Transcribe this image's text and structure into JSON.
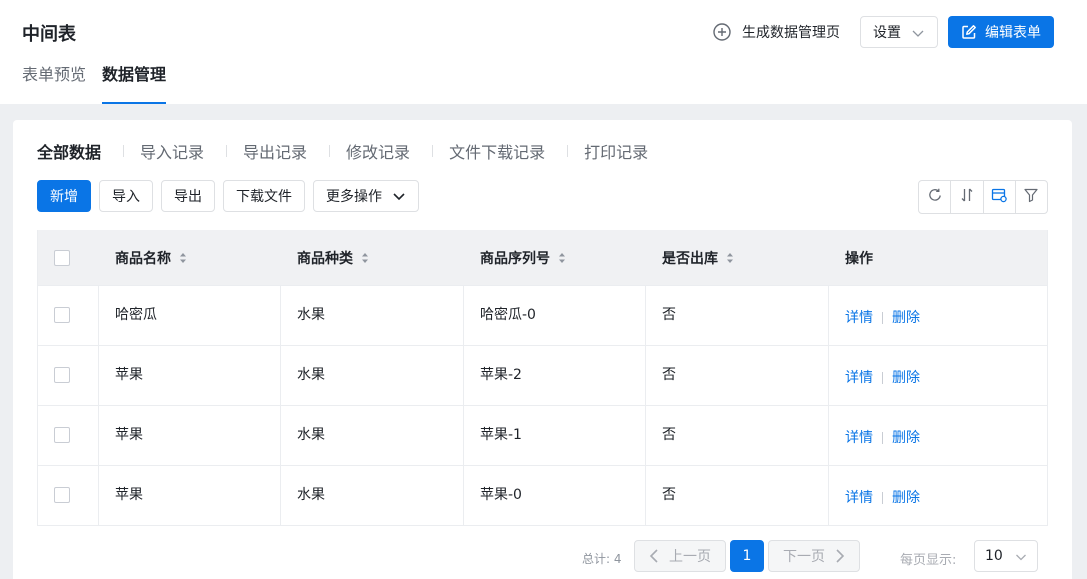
{
  "header": {
    "title": "中间表",
    "tabs": [
      {
        "label": "表单预览",
        "active": false
      },
      {
        "label": "数据管理",
        "active": true
      }
    ],
    "generate_label": "生成数据管理页",
    "settings_label": "设置",
    "edit_label": "编辑表单"
  },
  "sub_tabs": [
    "全部数据",
    "导入记录",
    "导出记录",
    "修改记录",
    "文件下载记录",
    "打印记录"
  ],
  "toolbar": {
    "add_label": "新增",
    "import_label": "导入",
    "export_label": "导出",
    "download_label": "下载文件",
    "more_label": "更多操作"
  },
  "table": {
    "columns": [
      "商品名称",
      "商品种类",
      "商品序列号",
      "是否出库",
      "操作"
    ],
    "rows": [
      {
        "name": "哈密瓜",
        "type": "水果",
        "sn": "哈密瓜-0",
        "out": "否"
      },
      {
        "name": "苹果",
        "type": "水果",
        "sn": "苹果-2",
        "out": "否"
      },
      {
        "name": "苹果",
        "type": "水果",
        "sn": "苹果-1",
        "out": "否"
      },
      {
        "name": "苹果",
        "type": "水果",
        "sn": "苹果-0",
        "out": "否"
      }
    ],
    "detail_label": "详情",
    "delete_label": "删除"
  },
  "pagination": {
    "total": "总计: 4",
    "prev_label": "上一页",
    "next_label": "下一页",
    "current_page": "1",
    "per_page_label": "每页显示:",
    "per_page_value": "10"
  },
  "colors": {
    "primary": "#0a75e6",
    "header_bg": "#f0f1f3",
    "page_bg": "#edeff2"
  },
  "icons": [
    "plus-circle-icon",
    "chevron-down-icon",
    "edit-icon",
    "refresh-icon",
    "sort-icon",
    "column-settings-icon",
    "filter-icon",
    "sort-arrows-icon",
    "chevron-left-icon",
    "chevron-right-icon"
  ]
}
